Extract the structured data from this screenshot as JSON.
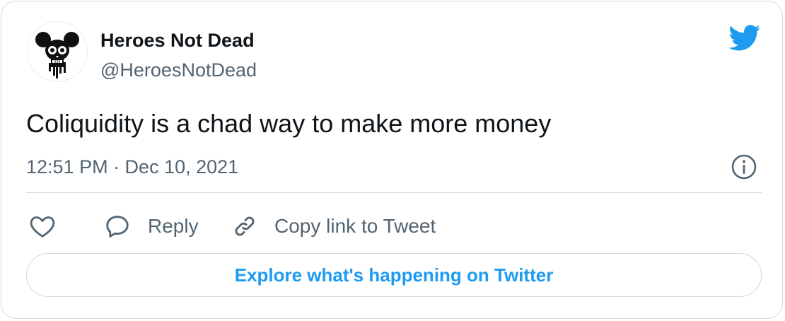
{
  "tweet": {
    "author": {
      "display_name": "Heroes Not Dead",
      "handle": "@HeroesNotDead",
      "avatar_icon": "skull-mouse-ears-icon"
    },
    "text": "Coliquidity is a chad way to make more money",
    "timestamp": "12:51 PM · Dec 10, 2021",
    "brand_icon": "twitter-bird-icon",
    "info_icon": "info-icon"
  },
  "actions": {
    "like_icon": "heart-icon",
    "reply_icon": "speech-bubble-icon",
    "reply_label": "Reply",
    "copy_icon": "link-icon",
    "copy_label": "Copy link to Tweet"
  },
  "explore": {
    "label": "Explore what's happening on Twitter"
  },
  "colors": {
    "brand": "#1d9bf0",
    "text_primary": "#0f1419",
    "text_secondary": "#536471",
    "border": "#cfd9de"
  }
}
